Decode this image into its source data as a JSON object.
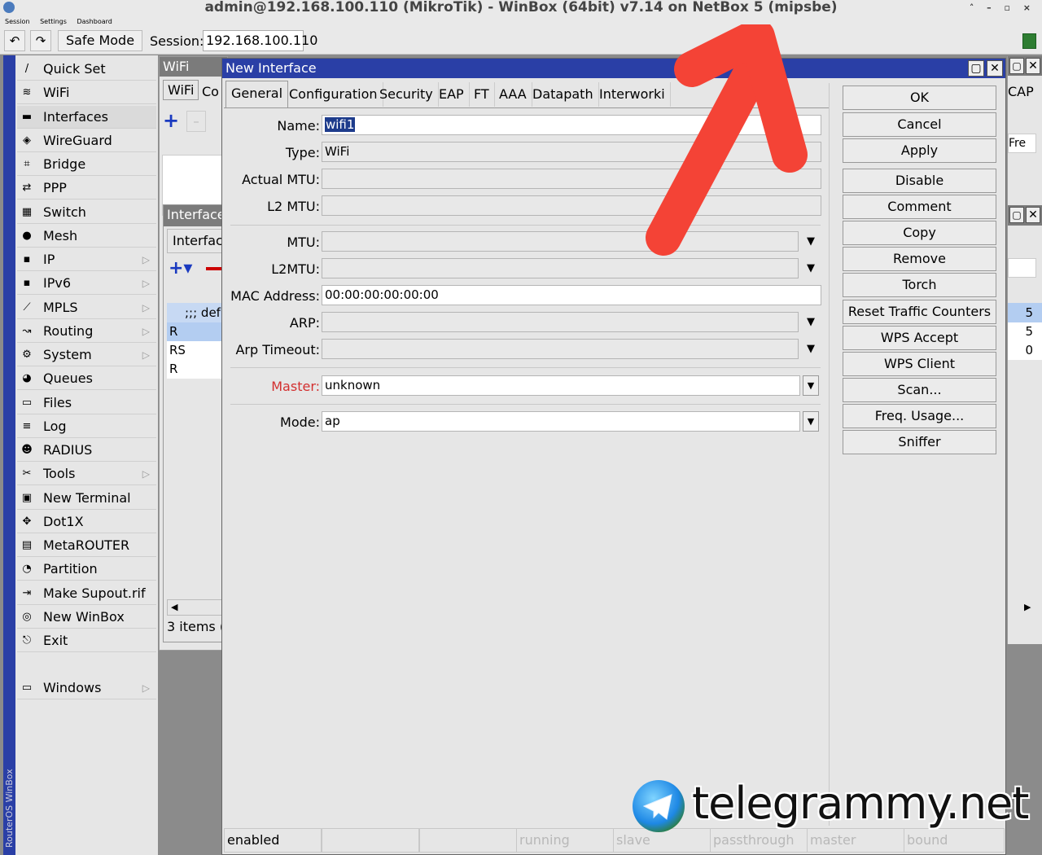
{
  "window": {
    "title": "admin@192.168.100.110 (MikroTik) - WinBox (64bit) v7.14 on NetBox 5 (mipsbe)"
  },
  "menubar": {
    "items": [
      "Session",
      "Settings",
      "Dashboard"
    ]
  },
  "toolbar": {
    "safe_mode": "Safe Mode",
    "session_label": "Session:",
    "session_value": "192.168.100.110"
  },
  "side_strip": "RouterOS WinBox",
  "sidebar": {
    "items": [
      {
        "label": "Quick Set",
        "icon": "wand-icon"
      },
      {
        "label": "WiFi",
        "icon": "wifi-icon"
      },
      {
        "label": "Interfaces",
        "icon": "interfaces-icon"
      },
      {
        "label": "WireGuard",
        "icon": "wireguard-icon"
      },
      {
        "label": "Bridge",
        "icon": "bridge-icon"
      },
      {
        "label": "PPP",
        "icon": "ppp-icon"
      },
      {
        "label": "Switch",
        "icon": "switch-icon"
      },
      {
        "label": "Mesh",
        "icon": "mesh-icon"
      },
      {
        "label": "IP",
        "icon": "ip-icon"
      },
      {
        "label": "IPv6",
        "icon": "ipv6-icon"
      },
      {
        "label": "MPLS",
        "icon": "mpls-icon"
      },
      {
        "label": "Routing",
        "icon": "routing-icon"
      },
      {
        "label": "System",
        "icon": "system-icon"
      },
      {
        "label": "Queues",
        "icon": "queues-icon"
      },
      {
        "label": "Files",
        "icon": "files-icon"
      },
      {
        "label": "Log",
        "icon": "log-icon"
      },
      {
        "label": "RADIUS",
        "icon": "radius-icon"
      },
      {
        "label": "Tools",
        "icon": "tools-icon"
      },
      {
        "label": "New Terminal",
        "icon": "terminal-icon"
      },
      {
        "label": "Dot1X",
        "icon": "dot1x-icon"
      },
      {
        "label": "MetaROUTER",
        "icon": "metarouter-icon"
      },
      {
        "label": "Partition",
        "icon": "partition-icon"
      },
      {
        "label": "Make Supout.rif",
        "icon": "supout-icon"
      },
      {
        "label": "New WinBox",
        "icon": "winbox-icon"
      },
      {
        "label": "Exit",
        "icon": "exit-icon"
      },
      {
        "label": "Windows",
        "icon": "windows-icon"
      }
    ]
  },
  "wifi_window": {
    "title": "WiFi",
    "tab1": "WiFi",
    "tab2": "Co",
    "cap_tab": "CAP",
    "fre": "Fre"
  },
  "interface_window": {
    "title": "Interface",
    "tab": "Interfac",
    "row0": ";;; def",
    "rows": [
      "R",
      "RS",
      "R"
    ],
    "right_vals": [
      "5",
      "5",
      "0"
    ],
    "items": "3 items ("
  },
  "dialog": {
    "title": "New Interface",
    "tabs": [
      "General",
      "Configuration",
      "Security",
      "EAP",
      "FT",
      "AAA",
      "Datapath",
      "Interworki"
    ],
    "fields": {
      "name_label": "Name:",
      "name_value": "wifi1",
      "type_label": "Type:",
      "type_value": "WiFi",
      "actual_mtu_label": "Actual MTU:",
      "l2mtu_ro_label": "L2 MTU:",
      "mtu_label": "MTU:",
      "l2mtu_label": "L2MTU:",
      "mac_label": "MAC Address:",
      "mac_value": "00:00:00:00:00:00",
      "arp_label": "ARP:",
      "arp_timeout_label": "Arp Timeout:",
      "master_label": "Master:",
      "master_value": "unknown",
      "mode_label": "Mode:",
      "mode_value": "ap"
    },
    "buttons": [
      "OK",
      "Cancel",
      "Apply",
      "Disable",
      "Comment",
      "Copy",
      "Remove",
      "Torch",
      "Reset Traffic Counters",
      "WPS Accept",
      "WPS Client",
      "Scan...",
      "Freq. Usage...",
      "Sniffer"
    ],
    "status": [
      "enabled",
      "",
      "",
      "running",
      "slave",
      "passthrough",
      "master",
      "bound"
    ]
  },
  "watermark": "telegrammy.net",
  "colors": {
    "accent": "#2a3fa6",
    "master_label": "#d32f2f",
    "arrow": "#f44336"
  }
}
